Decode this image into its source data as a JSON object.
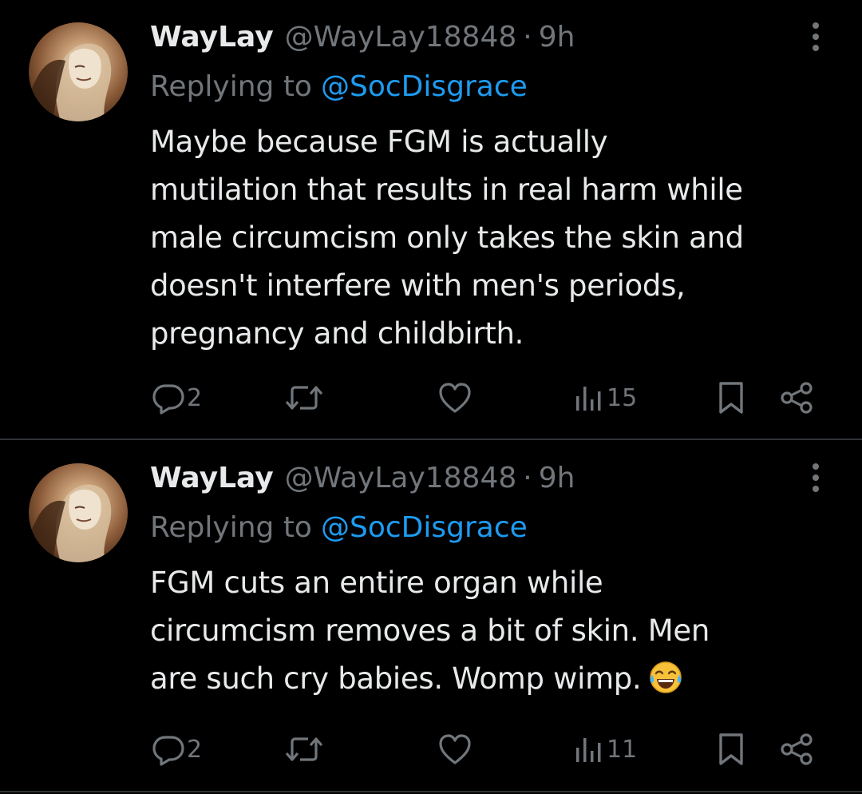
{
  "colors": {
    "background": "#000000",
    "primary_text": "#e7e9ea",
    "secondary_text": "#71767b",
    "link": "#1d9bf0",
    "divider": "#2f3336"
  },
  "tweets": [
    {
      "display_name": "WayLay",
      "handle": "@WayLay18848",
      "separator": "·",
      "time": "9h",
      "replying_label": "Replying to",
      "replying_to": "@SocDisgrace",
      "text_lines": [
        "Maybe because FGM is actually",
        "mutilation that results in real harm while",
        "male circumcism only takes the skin and",
        "doesn't interfere with men's periods,",
        "pregnancy and childbirth."
      ],
      "emoji": "",
      "replies": "2",
      "retweets": "",
      "likes": "",
      "views": "15",
      "icons": [
        "more-icon",
        "reply-icon",
        "retweet-icon",
        "like-icon",
        "views-icon",
        "bookmark-icon",
        "share-icon"
      ]
    },
    {
      "display_name": "WayLay",
      "handle": "@WayLay18848",
      "separator": "·",
      "time": "9h",
      "replying_label": "Replying to",
      "replying_to": "@SocDisgrace",
      "text_lines": [
        "FGM cuts an entire organ while",
        "circumcism removes a bit of skin. Men",
        "are such cry babies. Womp wimp."
      ],
      "emoji": "face-with-tears-of-joy",
      "replies": "2",
      "retweets": "",
      "likes": "",
      "views": "11",
      "icons": [
        "more-icon",
        "reply-icon",
        "retweet-icon",
        "like-icon",
        "views-icon",
        "bookmark-icon",
        "share-icon"
      ]
    }
  ]
}
